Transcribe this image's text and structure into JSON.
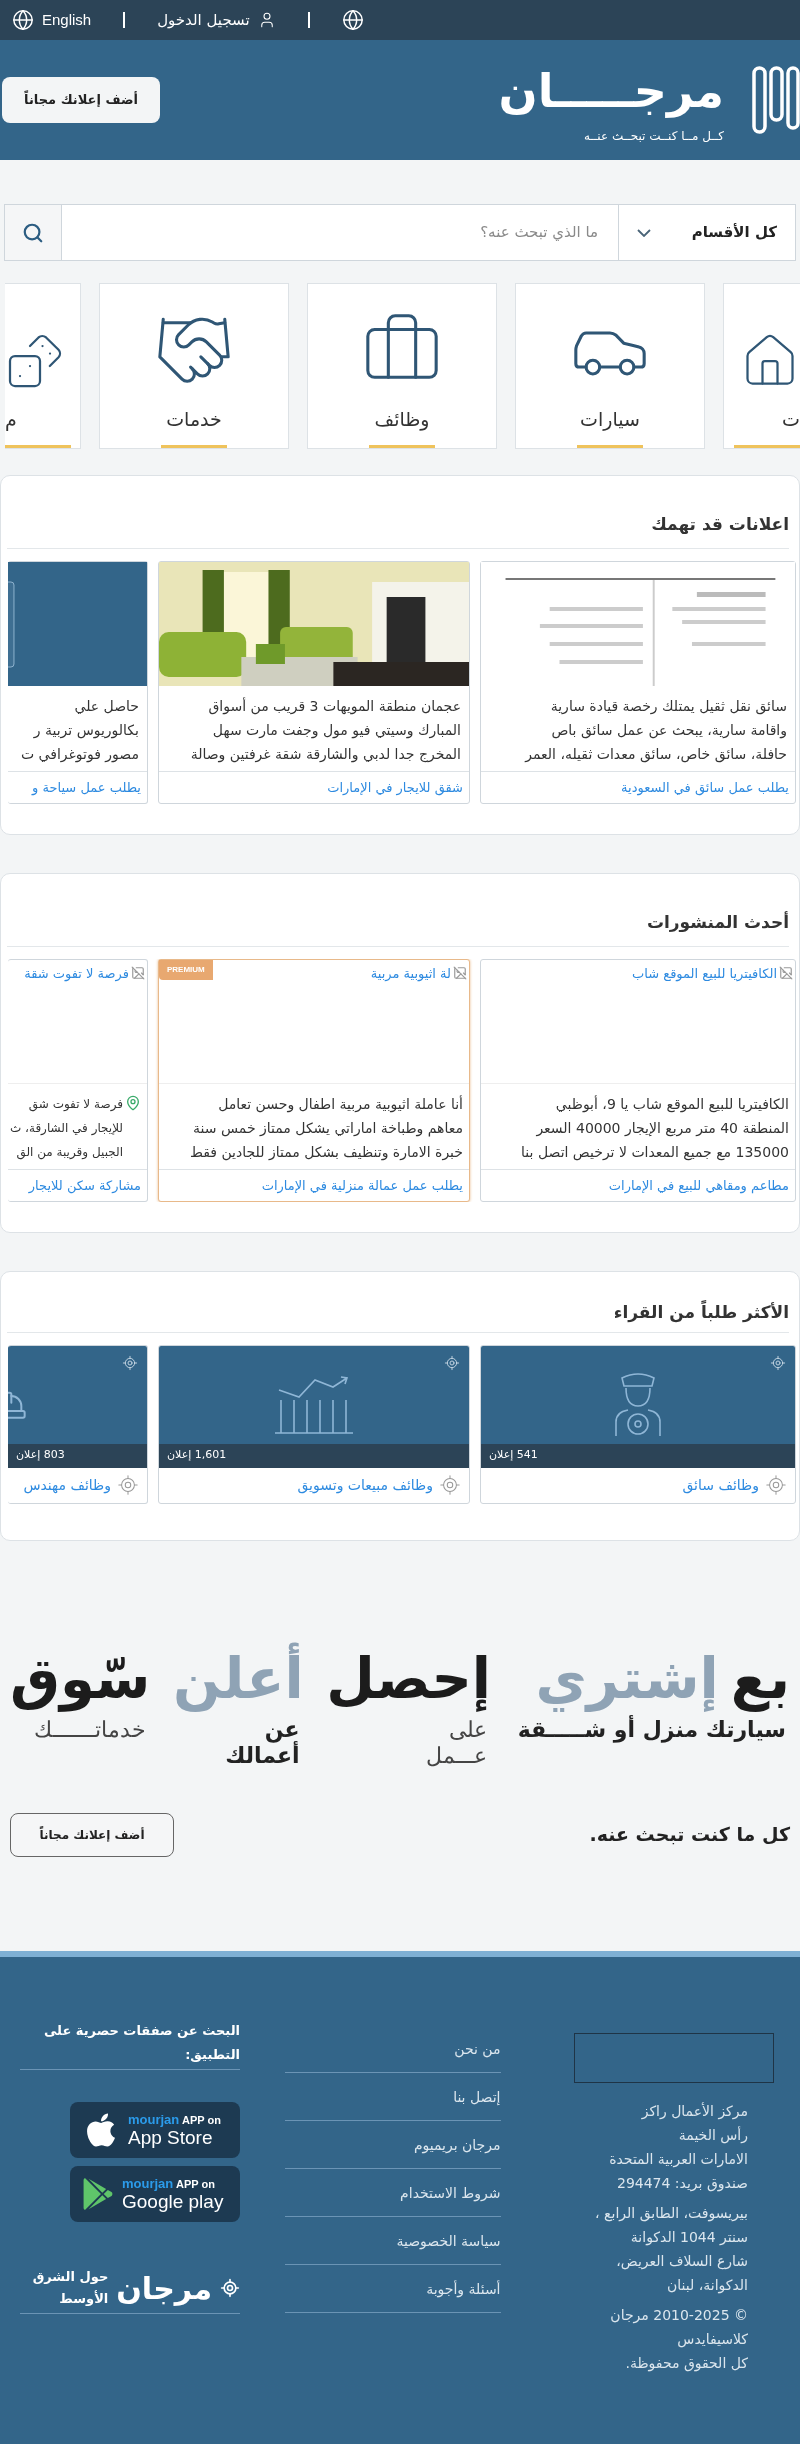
{
  "top_bar": {
    "language": "English",
    "login": "تسجيل الدخول"
  },
  "header": {
    "logo_name": "مرجـــــان",
    "tagline": "كــل مــا كنــت تبحــث عنــه",
    "post_button": "أضف إعلانك مجاناً"
  },
  "search": {
    "category": "كل الأقسام",
    "placeholder": "ما الذي تبحث عنه؟"
  },
  "categories": [
    {
      "label": "ت",
      "kind": "house"
    },
    {
      "label": "سيارات",
      "kind": "car"
    },
    {
      "label": "وظائف",
      "kind": "briefcase"
    },
    {
      "label": "خدمات",
      "kind": "handshake"
    },
    {
      "label": "م",
      "kind": "dice"
    }
  ],
  "featured": {
    "title": "اعلانات قد تهمك",
    "items": [
      {
        "kind": "picture",
        "text": "سائق نقل ثقيل يمتلك رخصة قيادة سارية\nواقامة سارية، يبحث عن عمل سائق باص\nحافلة، سائق خاص، سائق معدات ثقيله، العمر",
        "link": "يطلب عمل سائق في السعودية"
      },
      {
        "kind": "picture",
        "text": "عجمان منطقة المويهات 3 قريب من أسواق\nالمبارك وسيتي فيو مول وجفت مارت سهل\nالمخرج جدا لدبي والشارقة شقة غرفتين وصالة",
        "link": "شقق للايجار في الإمارات"
      },
      {
        "kind": "picture",
        "text": "حاصل علي\nبكالوريوس تربية ر\nمصور فوتوغرافي ت",
        "link": "يطلب عمل سياحة و"
      }
    ]
  },
  "latest": {
    "title": "أحدث المنشورات",
    "items": [
      {
        "alt": "الكافيتريا للبيع الموقع شاب",
        "premium": false,
        "has_location": false,
        "text": "الكافيتريا للبيع الموقع شاب يا 9، أبوظبي\nالمنطقة 40 متر مربع الإيجار 40000 السعر\n135000 مع جميع المعدات لا ترخيص اتصل بنا",
        "link": "مطاعم ومقاهي للبيع في الإمارات"
      },
      {
        "alt": "لة اثيوبية مربية",
        "premium": true,
        "badge": "PREMIUM",
        "has_location": false,
        "text": "أنا عاملة اثيوبية مربية اطفال وحسن تعامل\nمعاهم وطباخة اماراتي يشكل ممتاز خمس سنة\nخبرة الامارة وتنظيف بشكل ممتاز للجادين فقط",
        "link": "يطلب عمل عمالة منزلية في الإمارات"
      },
      {
        "alt": "فرصة لا تفوت شقة",
        "premium": false,
        "has_location": true,
        "text": "فرصة لا تفوت شق\nللإيجار في الشارقة، ث\nالجبيل وقريبة من الق",
        "link": "مشاركة سكن للايجار"
      }
    ]
  },
  "most_requested": {
    "title": "الأكثر طلباً من القراء",
    "items": [
      {
        "kind": "driver",
        "count": "541 إعلان",
        "link": "وظائف سائق"
      },
      {
        "kind": "chart",
        "count": "1,601 إعلان",
        "link": "وظائف مبيعات وتسويق"
      },
      {
        "kind": "engineer",
        "count": "803 إعلان",
        "link": "وظائف مهندس"
      }
    ]
  },
  "hero": {
    "columns": [
      {
        "words": [
          {
            "text": "بع",
            "muted": false
          },
          {
            "text": "إشتري",
            "muted": true
          }
        ],
        "sub": "سيارتك منزل أو شـــــقة",
        "sub_bold": true
      },
      {
        "words": [
          {
            "text": "إحصل",
            "muted": false
          }
        ],
        "sub": "على\nعـــمل",
        "sub_bold": false
      },
      {
        "words": [
          {
            "text": "أعلن",
            "muted": true
          }
        ],
        "sub": "عن\nأعمالك",
        "sub_bold": true
      },
      {
        "words": [
          {
            "text": "سّوق",
            "muted": false
          }
        ],
        "sub": "خدماتـــــــك",
        "sub_bold": false
      }
    ],
    "tagline": "كل ما كنت تبحث عنه.",
    "button": "أضف إعلانك مجاناً"
  },
  "footer": {
    "address": [
      "مركز الأعمال راكز\nرأس الخيمة\nالامارات العربية المتحدة\nصندوق بريد: 294474",
      "بيريسوفت، الطابق الرابع ،\nسنتر 1044 الدكوانة\nشارع السلاف العريض،\nالدكوانة، لبنان",
      "© 2010-2025 مرجان\nكلاسيفايدس\nكل الحقوق محفوظة."
    ],
    "links": [
      "من نحن",
      "إتصل بنا",
      "مرجان بريميوم",
      "شروط الاستخدام",
      "سياسة الخصوصية",
      "أسئلة وأجوبة"
    ],
    "app_heading": "البحث عن صفقات حصرية على التطبيق:",
    "apps": [
      {
        "kind": "apple",
        "brand": "mourjan",
        "prefix": "APP on",
        "store": "App Store"
      },
      {
        "kind": "google",
        "brand": "mourjan",
        "prefix": "APP on",
        "store": "Google play"
      }
    ],
    "brand": {
      "name": "مرجان",
      "tagline": "حول الشرق الأوسط"
    }
  }
}
